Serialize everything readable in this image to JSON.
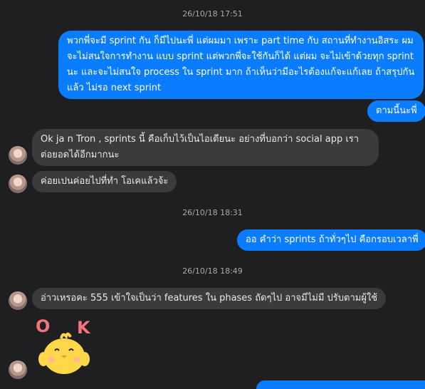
{
  "conversation": {
    "timestamps": [
      "26/10/18 17:51",
      "26/10/18 18:31",
      "26/10/18 18:49"
    ],
    "messages": [
      {
        "sender": "me",
        "text": "พวกพี่จะมี sprint กัน ก็มีไปนะพี่ แต่ผมมา เพราะ part time กับ สถานที่ทำงานอิสระ ผม จะไม่สนใจการทำงาน แบบ sprint แต่พวกพี่จะใช้กันก็ได้ แต่ผม จะไม่เข้าด้วยทุก sprint นะ และจะไม่สนใจ process ใน sprint มาก ถ้าเห็นว่ามีอะไรต้องแก้จะแก้เลย ถ้าสรุปกัน แล้ว ไม่รอ next sprint"
      },
      {
        "sender": "me",
        "text": "ตามนี้นะพี่"
      },
      {
        "sender": "contact",
        "text": "Ok ja n Tron , sprints นี้ คือเก็บไว้เป็นไอเดียนะ อย่างที่บอกว่า social app เราต่อยอดได้อีกมากนะ"
      },
      {
        "sender": "contact",
        "text": "ค่อยเปนค่อยไปที่ทำ โอเคแล้วจ้ะ"
      },
      {
        "sender": "me",
        "text": "ออ คำว่า sprints ถ้าทั่วๆไป คือกรอบเวลาพี่"
      },
      {
        "sender": "contact",
        "text": "อ่าวเหรอคะ 555 เข้าใจเป็นว่า features ใน phases ถัดๆไป อาจมีไม่มี ปรับตามผู้ใช้"
      }
    ],
    "sticker": {
      "name": "ok-chick-sticker",
      "letters": [
        "O",
        "K"
      ]
    }
  },
  "colors": {
    "background": "#1f1f21",
    "outgoing_bubble": "#0a7cff",
    "incoming_bubble": "#3a3b3d",
    "timestamp": "#a8a8ad",
    "sticker_letters": "#f2747f",
    "chick": "#ffd84a"
  }
}
